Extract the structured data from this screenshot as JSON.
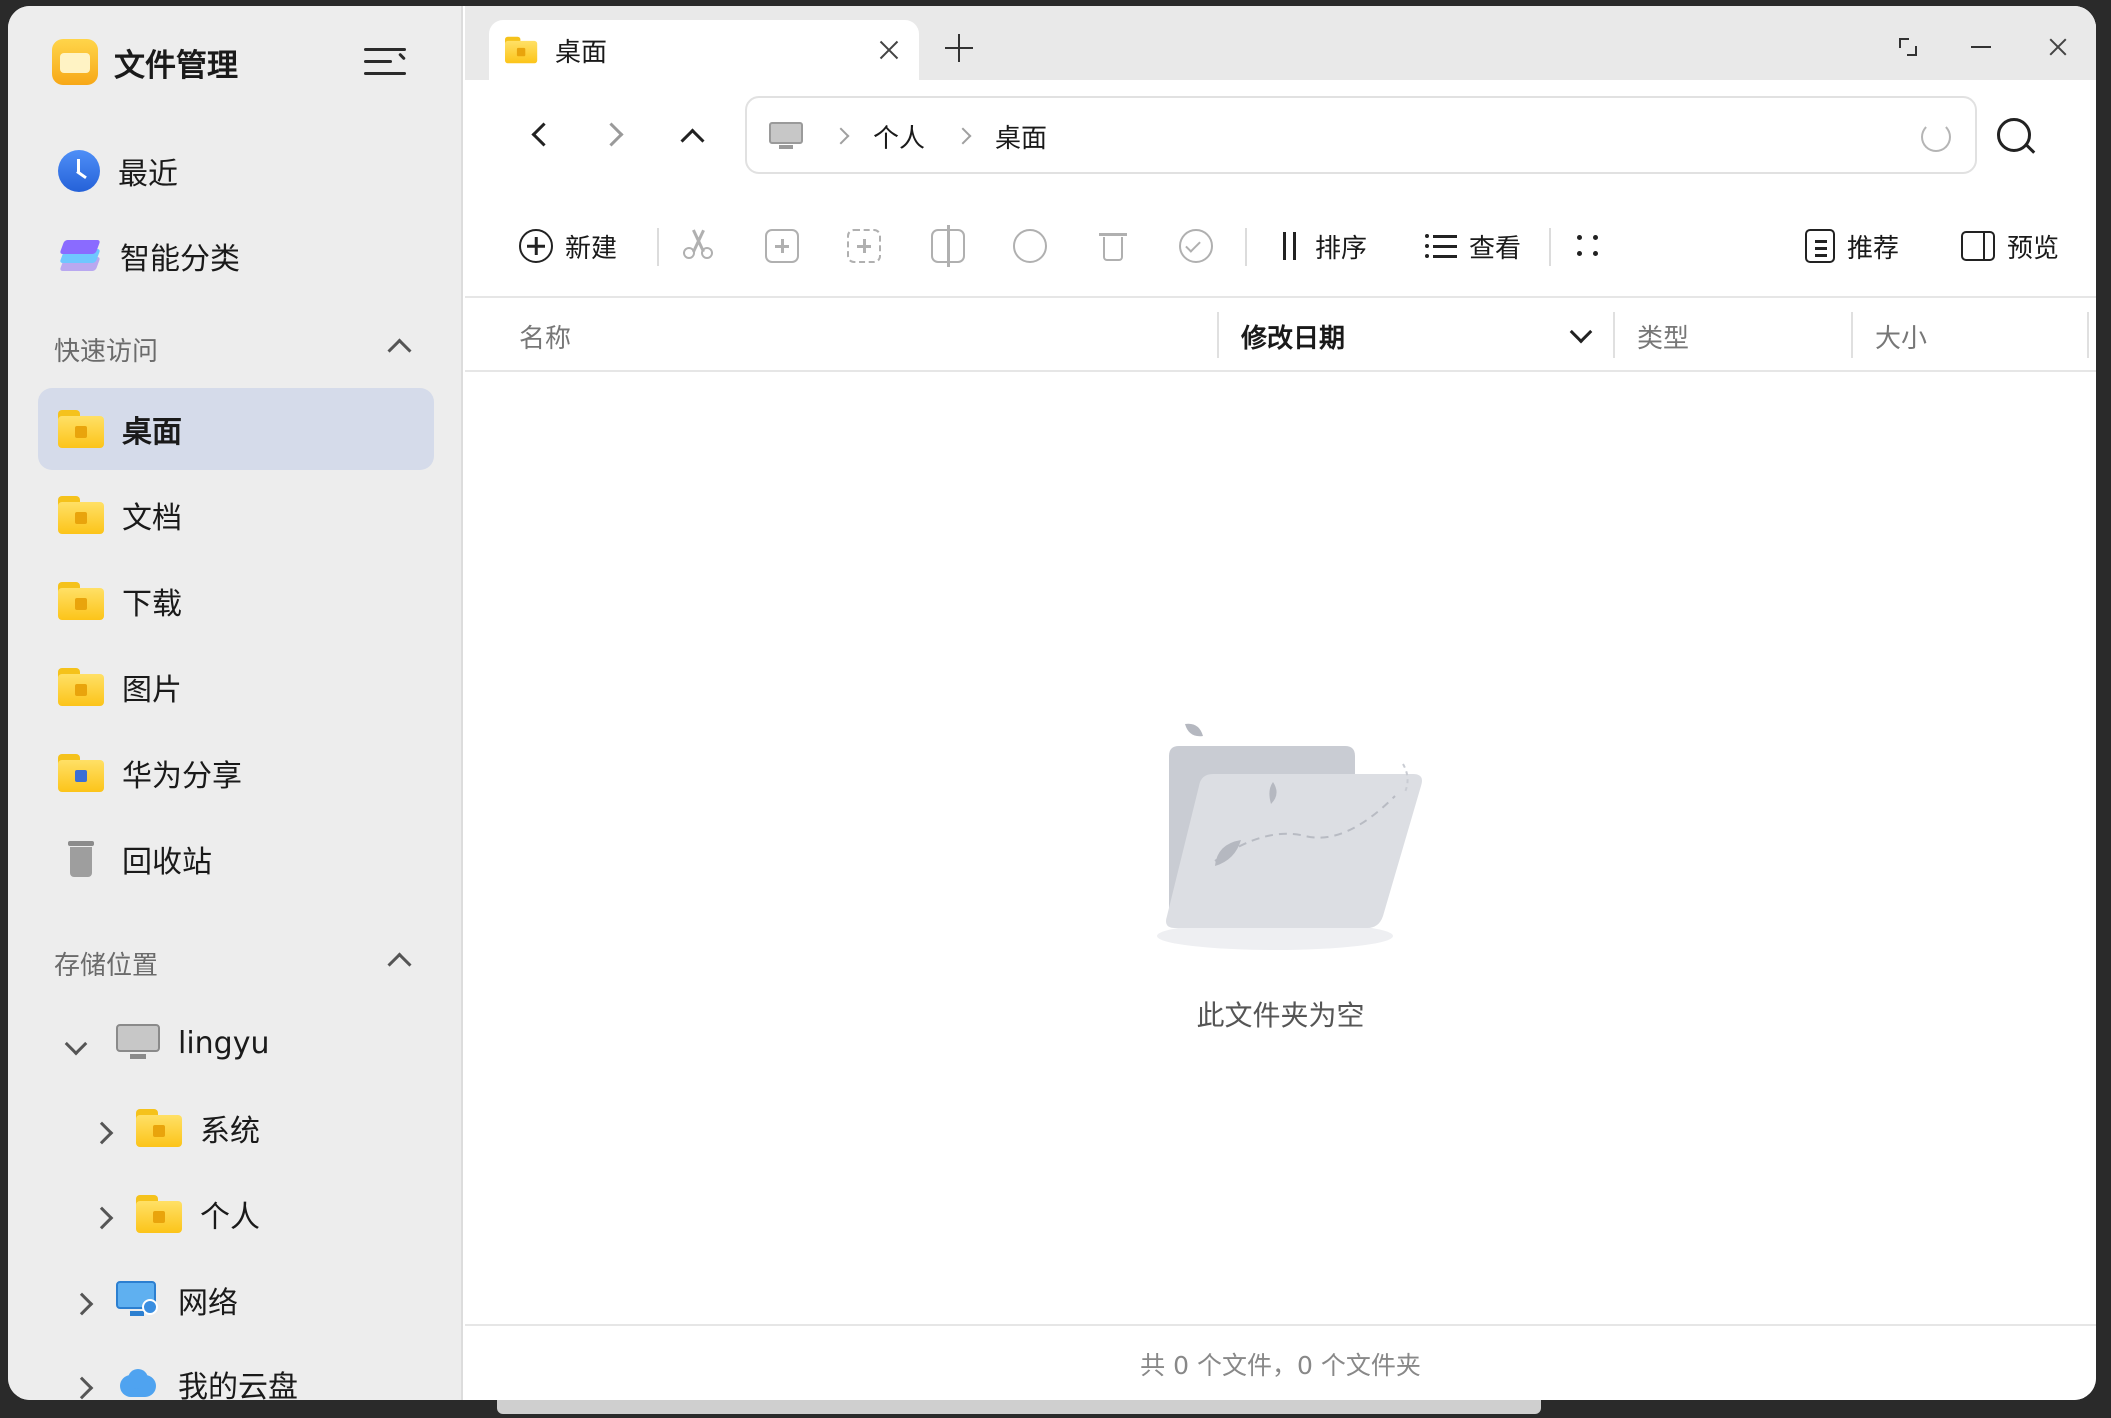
{
  "app": {
    "title": "文件管理"
  },
  "sidebar": {
    "top_items": [
      {
        "label": "最近",
        "icon": "clock-icon"
      },
      {
        "label": "智能分类",
        "icon": "stack-icon"
      }
    ],
    "quick_access": {
      "title": "快速访问",
      "items": [
        {
          "label": "桌面",
          "icon": "folder-icon",
          "active": true
        },
        {
          "label": "文档",
          "icon": "folder-icon"
        },
        {
          "label": "下载",
          "icon": "folder-icon"
        },
        {
          "label": "图片",
          "icon": "folder-icon"
        },
        {
          "label": "华为分享",
          "icon": "folder-icon"
        },
        {
          "label": "回收站",
          "icon": "trash-icon"
        }
      ]
    },
    "storage": {
      "title": "存储位置",
      "items": [
        {
          "label": "lingyu",
          "icon": "computer-icon",
          "expanded": true
        },
        {
          "label": "系统",
          "icon": "folder-icon"
        },
        {
          "label": "个人",
          "icon": "folder-icon"
        },
        {
          "label": "网络",
          "icon": "network-icon"
        },
        {
          "label": "我的云盘",
          "icon": "cloud-icon"
        }
      ]
    }
  },
  "tabs": [
    {
      "label": "桌面",
      "active": true
    }
  ],
  "breadcrumb": [
    "个人",
    "桌面"
  ],
  "toolbar": {
    "new_label": "新建",
    "sort_label": "排序",
    "view_label": "查看",
    "recommend_label": "推荐",
    "preview_label": "预览"
  },
  "columns": {
    "name": "名称",
    "modified": "修改日期",
    "type": "类型",
    "size": "大小",
    "sorted_by": "修改日期"
  },
  "empty_state": {
    "message": "此文件夹为空"
  },
  "status": {
    "summary": "共 0 个文件，0 个文件夹"
  },
  "colors": {
    "sidebar_bg": "#ededed",
    "active_item_bg": "#d5dbea",
    "folder_yellow": "#fcc419",
    "accent_blue": "#3b6fd6"
  }
}
